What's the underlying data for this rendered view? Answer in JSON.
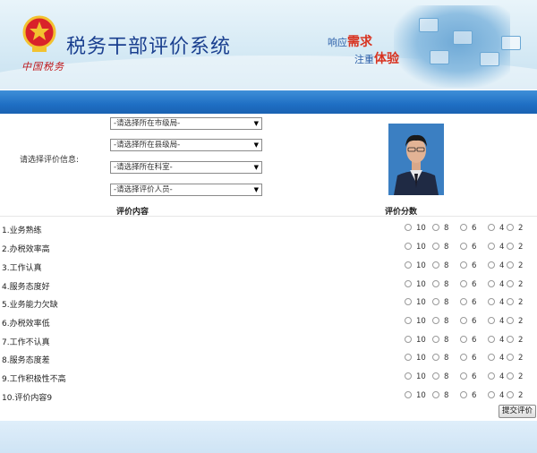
{
  "header": {
    "title": "税务干部评价系统",
    "brand_sub": "中国税务",
    "slogan_line1_a": "响应",
    "slogan_line1_b": "需求",
    "slogan_line2_a": "注重",
    "slogan_line2_b": "体验"
  },
  "info": {
    "label": "请选择评价信息:",
    "selects": [
      "-请选择所在市级局-",
      "-请选择所在县级局-",
      "-请选择所在科室-",
      "-请选择评价人员-"
    ]
  },
  "table": {
    "col_content": "评价内容",
    "col_score": "评价分数",
    "score_options": [
      "10",
      "8",
      "6",
      "4",
      "2"
    ],
    "items": [
      "1.业务熟练",
      "2.办税效率高",
      "3.工作认真",
      "4.服务态度好",
      "5.业务能力欠缺",
      "6.办税效率低",
      "7.工作不认真",
      "8.服务态度差",
      "9.工作积极性不高",
      "10.评价内容9"
    ]
  },
  "actions": {
    "submit": "提交评价"
  },
  "colors": {
    "title_blue": "#1a3f8f",
    "bar_blue": "#1f6fc4",
    "slogan_red": "#d8321f"
  }
}
